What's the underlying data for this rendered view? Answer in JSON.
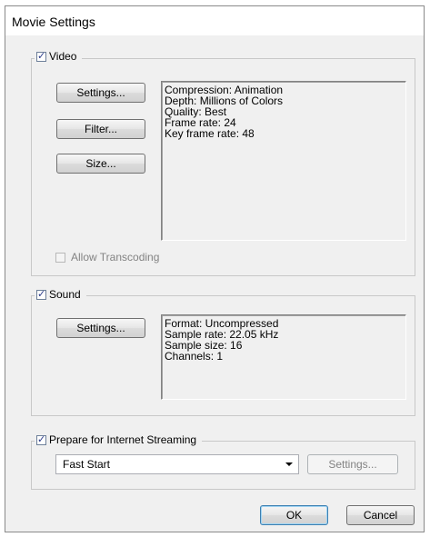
{
  "dialog": {
    "title": "Movie Settings"
  },
  "video": {
    "label": "Video",
    "checked": true,
    "buttons": {
      "settings": "Settings...",
      "filter": "Filter...",
      "size": "Size..."
    },
    "info": [
      "Compression: Animation",
      "Depth: Millions of Colors",
      "Quality: Best",
      "Frame rate: 24",
      "Key frame rate: 48"
    ],
    "allow_transcoding": {
      "label": "Allow Transcoding",
      "checked": false,
      "enabled": false
    }
  },
  "sound": {
    "label": "Sound",
    "checked": true,
    "buttons": {
      "settings": "Settings..."
    },
    "info": [
      "Format: Uncompressed",
      "Sample rate: 22.05 kHz",
      "Sample size: 16",
      "Channels: 1"
    ]
  },
  "streaming": {
    "label": "Prepare for Internet Streaming",
    "checked": true,
    "select_value": "Fast Start",
    "settings_label": "Settings...",
    "settings_enabled": false
  },
  "footer": {
    "ok": "OK",
    "cancel": "Cancel"
  },
  "icons": {
    "checkbox": "checkmark",
    "dropdown": "chevron-down-icon"
  }
}
